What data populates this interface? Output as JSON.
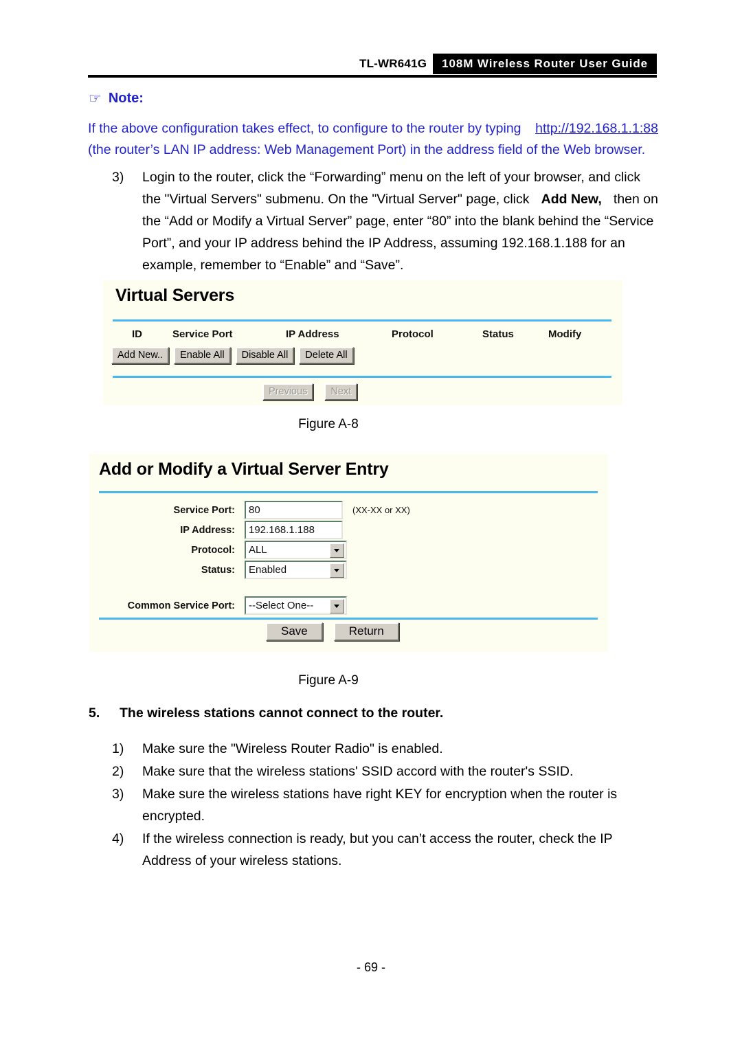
{
  "header": {
    "model": "TL-WR641G",
    "banner": "108M Wireless Router User Guide"
  },
  "note": {
    "icon": "pointing-hand-icon",
    "label": "Note:",
    "line1_a": "If the above configuration takes effect, to configure to the router by typing",
    "line1_link": "http://192.168.1.1:88",
    "line2": "(the router’s LAN IP address: Web Management Port) in the address field of the Web browser."
  },
  "step3": {
    "marker": "3)",
    "line1": "Login to the router, click the “Forwarding” menu on the left of your browser, and click",
    "line2_a": "the \"Virtual Servers\" submenu. On the \"Virtual Server\" page, click",
    "line2_bold": "Add New,",
    "line2_b": "then on",
    "line3": "the “Add or Modify a Virtual Server” page, enter “80” into the blank behind the “Service",
    "line4": "Port”, and your IP address behind the IP Address, assuming 192.168.1.188 for an",
    "line5": "example, remember to “Enable” and “Save”."
  },
  "figure_a8": {
    "caption": "Figure A-8",
    "title": "Virtual Servers",
    "columns": [
      "ID",
      "Service Port",
      "IP Address",
      "Protocol",
      "Status",
      "Modify"
    ],
    "action_buttons": [
      "Add New..",
      "Enable All",
      "Disable All",
      "Delete All"
    ],
    "pager_buttons": [
      "Previous",
      "Next"
    ]
  },
  "figure_a9": {
    "caption": "Figure A-9",
    "title": "Add or Modify a Virtual Server Entry",
    "fields": [
      {
        "label": "Service Port:",
        "value": "80",
        "hint": "(XX-XX or XX)",
        "kind": "text"
      },
      {
        "label": "IP Address:",
        "value": "192.168.1.188",
        "hint": "",
        "kind": "text"
      },
      {
        "label": "Protocol:",
        "value": "ALL",
        "hint": "",
        "kind": "select"
      },
      {
        "label": "Status:",
        "value": "Enabled",
        "hint": "",
        "kind": "select"
      },
      {
        "label": "Common Service Port:",
        "value": "--Select One--",
        "hint": "",
        "kind": "select"
      }
    ],
    "save_label": "Save",
    "return_label": "Return"
  },
  "section5": {
    "number": "5.",
    "title": "The wireless stations cannot connect to the router.",
    "items": [
      {
        "marker": "1)",
        "line1": "Make sure the \"Wireless Router Radio\" is enabled.",
        "line2": ""
      },
      {
        "marker": "2)",
        "line1": "Make sure that the wireless stations' SSID accord with the router's SSID.",
        "line2": ""
      },
      {
        "marker": "3)",
        "line1": "Make sure the wireless stations have right KEY for encryption when the router is",
        "line2": "encrypted."
      },
      {
        "marker": "4)",
        "line1": "If the wireless connection is ready, but you can’t access the router, check the IP",
        "line2": "Address of your wireless stations."
      }
    ]
  },
  "footer": {
    "page_number": "- 69 -"
  },
  "colors": {
    "note_blue": "#2222cc",
    "ui_background": "#fdfdf0",
    "ui_divider_blue": "#49b8ee",
    "banner_background": "#000000"
  }
}
